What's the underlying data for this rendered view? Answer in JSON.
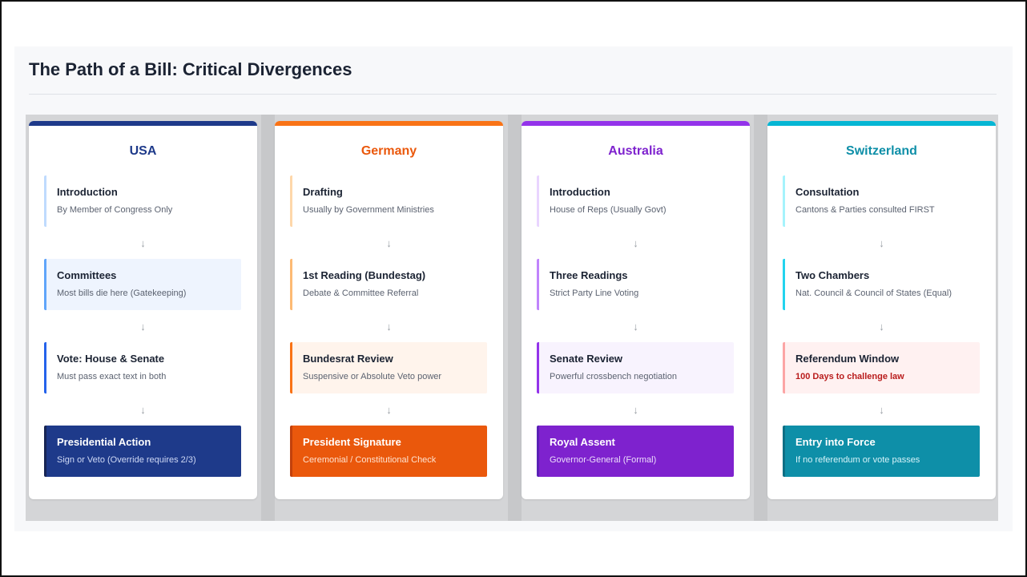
{
  "title": "The Path of a Bill: Critical Divergences",
  "arrow_glyph": "↓",
  "countries": [
    {
      "name": "USA",
      "color": "#1e3a8a",
      "steps": [
        {
          "title": "Introduction",
          "desc": "By Member of Congress Only"
        },
        {
          "title": "Committees",
          "desc": "Most bills die here (Gatekeeping)"
        },
        {
          "title": "Vote: House & Senate",
          "desc": "Must pass exact text in both"
        },
        {
          "title": "Presidential Action",
          "desc": "Sign or Veto (Override requires 2/3)"
        }
      ]
    },
    {
      "name": "Germany",
      "color": "#ea580c",
      "steps": [
        {
          "title": "Drafting",
          "desc": "Usually by Government Ministries"
        },
        {
          "title": "1st Reading (Bundestag)",
          "desc": "Debate & Committee Referral"
        },
        {
          "title": "Bundesrat Review",
          "desc": "Suspensive or Absolute Veto power"
        },
        {
          "title": "President Signature",
          "desc": "Ceremonial / Constitutional Check"
        }
      ]
    },
    {
      "name": "Australia",
      "color": "#7e22ce",
      "steps": [
        {
          "title": "Introduction",
          "desc": "House of Reps (Usually Govt)"
        },
        {
          "title": "Three Readings",
          "desc": "Strict Party Line Voting"
        },
        {
          "title": "Senate Review",
          "desc": "Powerful crossbench negotiation"
        },
        {
          "title": "Royal Assent",
          "desc": "Governor-General (Formal)"
        }
      ]
    },
    {
      "name": "Switzerland",
      "color": "#0e8fa8",
      "steps": [
        {
          "title": "Consultation",
          "desc": "Cantons & Parties consulted FIRST"
        },
        {
          "title": "Two Chambers",
          "desc": "Nat. Council & Council of States (Equal)"
        },
        {
          "title": "Referendum Window",
          "desc": "100 Days to challenge law"
        },
        {
          "title": "Entry into Force",
          "desc": "If no referendum or vote passes"
        }
      ]
    }
  ]
}
